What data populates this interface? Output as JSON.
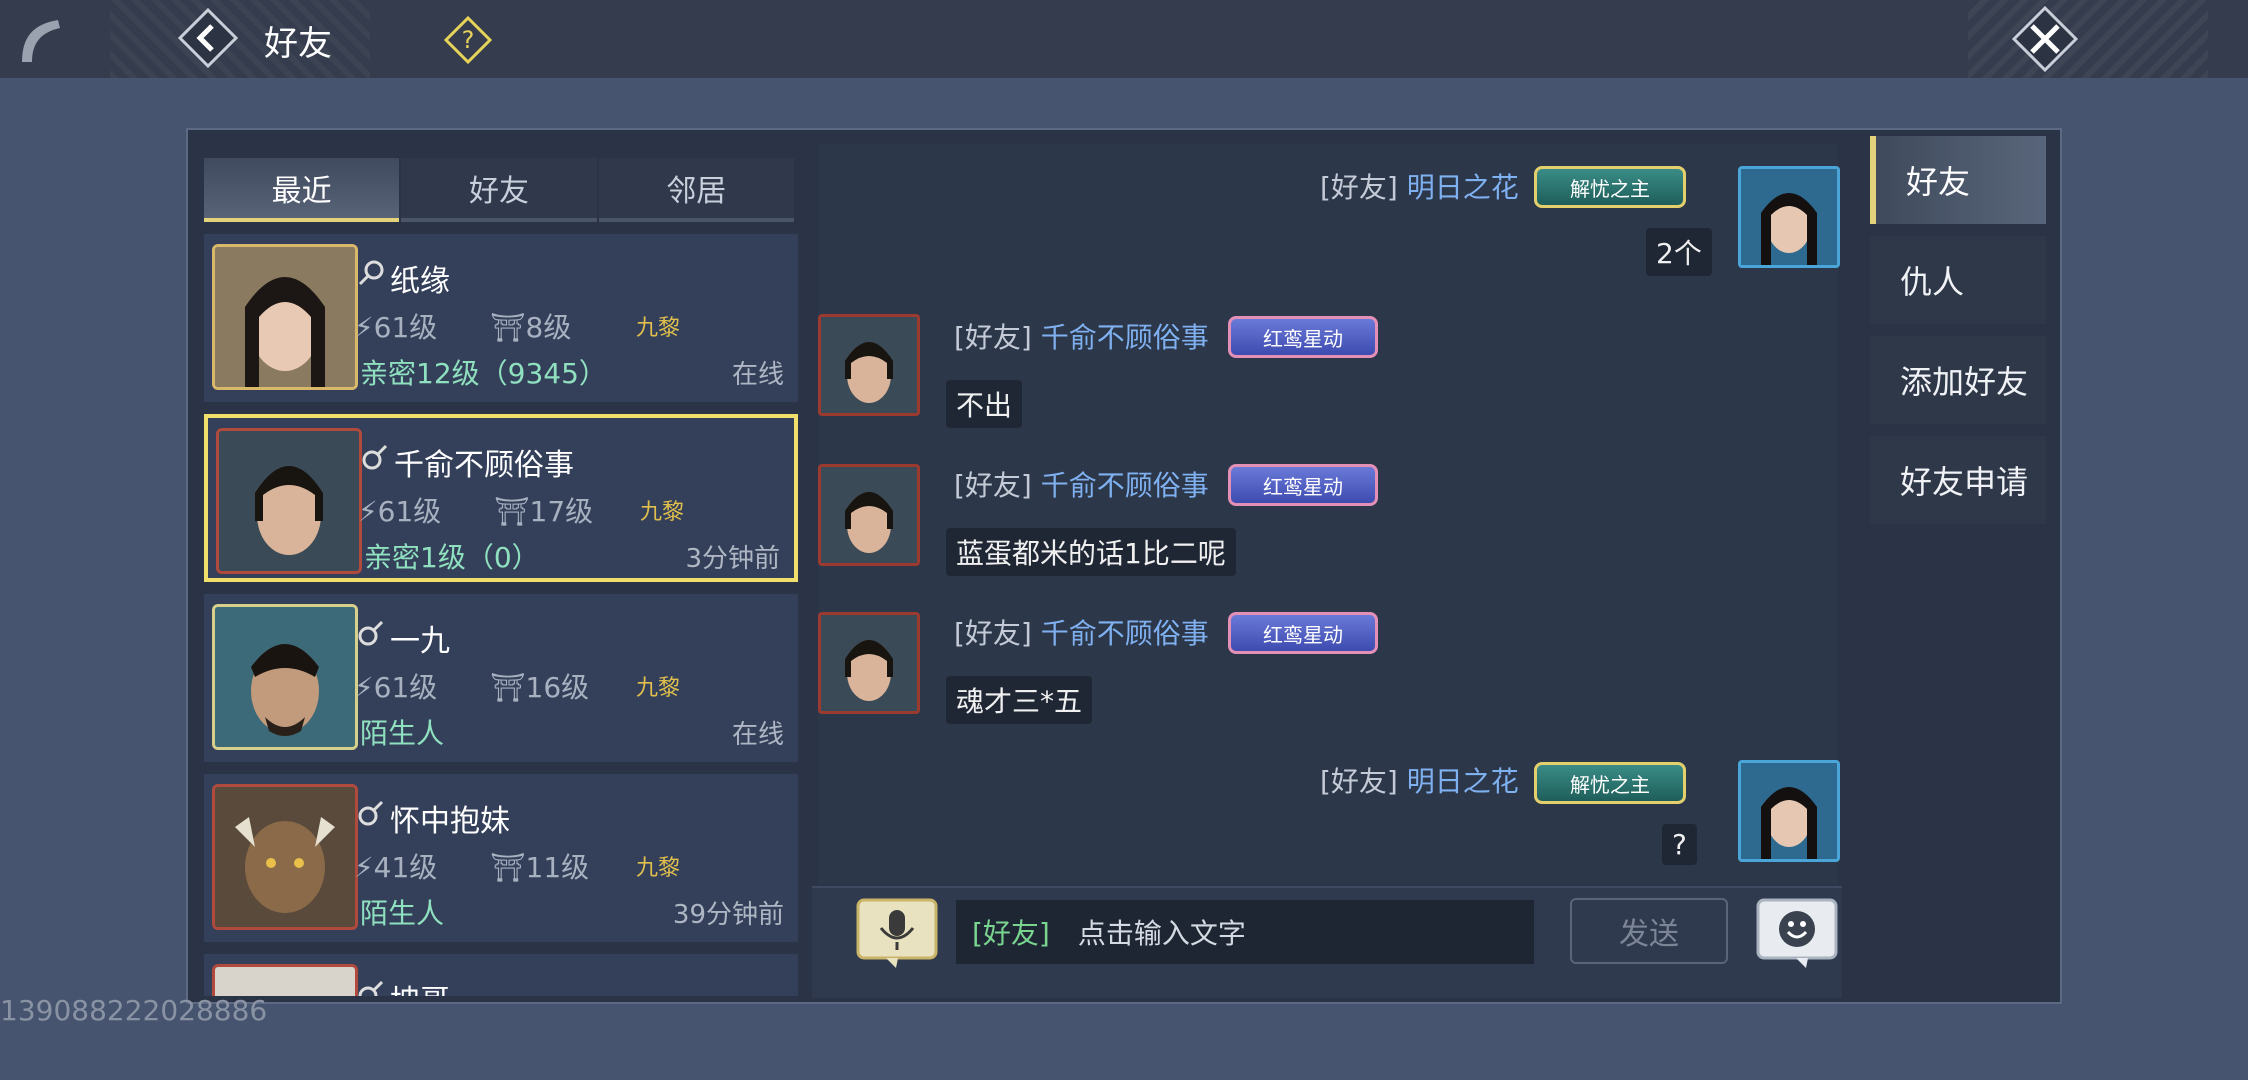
{
  "header": {
    "title": "好友"
  },
  "tabs": [
    {
      "label": "最近",
      "active": true
    },
    {
      "label": "好友",
      "active": false
    },
    {
      "label": "邻居",
      "active": false
    }
  ],
  "friends": [
    {
      "name": "纸缘",
      "gender": "female",
      "level": "61级",
      "house_level": "8级",
      "guild": "九黎",
      "intimacy": "亲密12级（9345）",
      "status": "在线",
      "selected": false
    },
    {
      "name": "千俞不顾俗事",
      "gender": "male",
      "level": "61级",
      "house_level": "17级",
      "guild": "九黎",
      "intimacy": "亲密1级（0）",
      "status": "3分钟前",
      "selected": true
    },
    {
      "name": "一九",
      "gender": "male",
      "level": "61级",
      "house_level": "16级",
      "guild": "九黎",
      "intimacy": "陌生人",
      "status": "在线",
      "selected": false
    },
    {
      "name": "怀中抱妹",
      "gender": "male",
      "level": "41级",
      "house_level": "11级",
      "guild": "九黎",
      "intimacy": "陌生人",
      "status": "39分钟前",
      "selected": false
    },
    {
      "name": "坤哥",
      "gender": "male"
    }
  ],
  "chat": {
    "messages": [
      {
        "side": "right",
        "channel": "[好友]",
        "name": "明日之花",
        "badge": "解忧之主",
        "text": "2个"
      },
      {
        "side": "left",
        "channel": "[好友]",
        "name": "千俞不顾俗事",
        "badge": "红鸾星动",
        "text": "不出"
      },
      {
        "side": "left",
        "channel": "[好友]",
        "name": "千俞不顾俗事",
        "badge": "红鸾星动",
        "text": "蓝蛋都米的话1比二呢"
      },
      {
        "side": "left",
        "channel": "[好友]",
        "name": "千俞不顾俗事",
        "badge": "红鸾星动",
        "text": "魂才三*五"
      },
      {
        "side": "right",
        "channel": "[好友]",
        "name": "明日之花",
        "badge": "解忧之主",
        "text": "?"
      }
    ],
    "input_channel": "[好友]",
    "input_placeholder": "点击输入文字",
    "send_label": "发送"
  },
  "side_tabs": [
    {
      "label": "好友",
      "active": true
    },
    {
      "label": "仇人",
      "active": false
    },
    {
      "label": "添加好友",
      "active": false
    },
    {
      "label": "好友申请",
      "active": false
    }
  ],
  "watermark": "139088222028886",
  "colors": {
    "background": "#475470",
    "panel": "#2a3446",
    "highlight": "#f0df6a",
    "name_blue": "#7fb0f0",
    "intimacy_green": "#8fe0bf"
  }
}
